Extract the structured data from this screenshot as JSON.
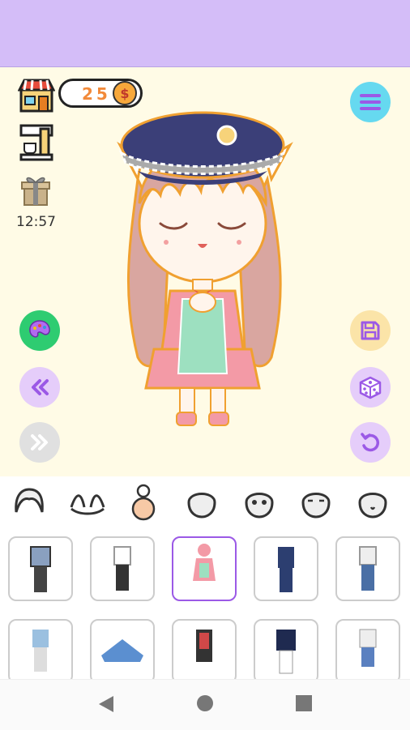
{
  "header": {
    "color": "#d4bdf8"
  },
  "status": {
    "coins": "25",
    "coin_symbol": "$",
    "time": "12:57"
  },
  "left_icons": [
    "shop-icon",
    "coffee-machine-icon",
    "gift-icon"
  ],
  "side_buttons": {
    "palette": "palette-icon",
    "prev": "double-chevron-left-icon",
    "next": "double-chevron-right-icon",
    "save": "save-icon",
    "random": "dice-icon",
    "undo": "undo-icon",
    "menu": "menu-icon"
  },
  "tabs": [
    "hair-icon",
    "ears-icon",
    "body-icon",
    "face-icon",
    "eyes-icon",
    "expression-icon",
    "mouth-icon"
  ],
  "selected_item_index": 2,
  "colors": {
    "accent": "#9b59e6",
    "button_purple": "#e5cdfa",
    "button_green": "#2ecc71",
    "button_cyan": "#66d9f0",
    "button_gray": "#e0e0e0",
    "button_yellow": "#fbe4a8"
  }
}
